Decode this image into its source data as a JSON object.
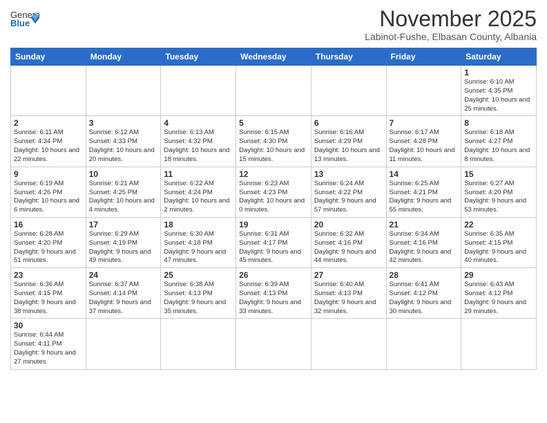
{
  "logo": {
    "general": "General",
    "blue": "Blue"
  },
  "header": {
    "month": "November 2025",
    "location": "Labinot-Fushe, Elbasan County, Albania"
  },
  "weekdays": [
    "Sunday",
    "Monday",
    "Tuesday",
    "Wednesday",
    "Thursday",
    "Friday",
    "Saturday"
  ],
  "weeks": [
    [
      {
        "day": "",
        "info": ""
      },
      {
        "day": "",
        "info": ""
      },
      {
        "day": "",
        "info": ""
      },
      {
        "day": "",
        "info": ""
      },
      {
        "day": "",
        "info": ""
      },
      {
        "day": "",
        "info": ""
      },
      {
        "day": "1",
        "info": "Sunrise: 6:10 AM\nSunset: 4:35 PM\nDaylight: 10 hours and 25 minutes."
      }
    ],
    [
      {
        "day": "2",
        "info": "Sunrise: 6:11 AM\nSunset: 4:34 PM\nDaylight: 10 hours and 22 minutes."
      },
      {
        "day": "3",
        "info": "Sunrise: 6:12 AM\nSunset: 4:33 PM\nDaylight: 10 hours and 20 minutes."
      },
      {
        "day": "4",
        "info": "Sunrise: 6:13 AM\nSunset: 4:32 PM\nDaylight: 10 hours and 18 minutes."
      },
      {
        "day": "5",
        "info": "Sunrise: 6:15 AM\nSunset: 4:30 PM\nDaylight: 10 hours and 15 minutes."
      },
      {
        "day": "6",
        "info": "Sunrise: 6:16 AM\nSunset: 4:29 PM\nDaylight: 10 hours and 13 minutes."
      },
      {
        "day": "7",
        "info": "Sunrise: 6:17 AM\nSunset: 4:28 PM\nDaylight: 10 hours and 11 minutes."
      },
      {
        "day": "8",
        "info": "Sunrise: 6:18 AM\nSunset: 4:27 PM\nDaylight: 10 hours and 8 minutes."
      }
    ],
    [
      {
        "day": "9",
        "info": "Sunrise: 6:19 AM\nSunset: 4:26 PM\nDaylight: 10 hours and 6 minutes."
      },
      {
        "day": "10",
        "info": "Sunrise: 6:21 AM\nSunset: 4:25 PM\nDaylight: 10 hours and 4 minutes."
      },
      {
        "day": "11",
        "info": "Sunrise: 6:22 AM\nSunset: 4:24 PM\nDaylight: 10 hours and 2 minutes."
      },
      {
        "day": "12",
        "info": "Sunrise: 6:23 AM\nSunset: 4:23 PM\nDaylight: 10 hours and 0 minutes."
      },
      {
        "day": "13",
        "info": "Sunrise: 6:24 AM\nSunset: 4:22 PM\nDaylight: 9 hours and 57 minutes."
      },
      {
        "day": "14",
        "info": "Sunrise: 6:25 AM\nSunset: 4:21 PM\nDaylight: 9 hours and 55 minutes."
      },
      {
        "day": "15",
        "info": "Sunrise: 6:27 AM\nSunset: 4:20 PM\nDaylight: 9 hours and 53 minutes."
      }
    ],
    [
      {
        "day": "16",
        "info": "Sunrise: 6:28 AM\nSunset: 4:20 PM\nDaylight: 9 hours and 51 minutes."
      },
      {
        "day": "17",
        "info": "Sunrise: 6:29 AM\nSunset: 4:19 PM\nDaylight: 9 hours and 49 minutes."
      },
      {
        "day": "18",
        "info": "Sunrise: 6:30 AM\nSunset: 4:18 PM\nDaylight: 9 hours and 47 minutes."
      },
      {
        "day": "19",
        "info": "Sunrise: 6:31 AM\nSunset: 4:17 PM\nDaylight: 9 hours and 45 minutes."
      },
      {
        "day": "20",
        "info": "Sunrise: 6:32 AM\nSunset: 4:16 PM\nDaylight: 9 hours and 44 minutes."
      },
      {
        "day": "21",
        "info": "Sunrise: 6:34 AM\nSunset: 4:16 PM\nDaylight: 9 hours and 42 minutes."
      },
      {
        "day": "22",
        "info": "Sunrise: 6:35 AM\nSunset: 4:15 PM\nDaylight: 9 hours and 40 minutes."
      }
    ],
    [
      {
        "day": "23",
        "info": "Sunrise: 6:36 AM\nSunset: 4:15 PM\nDaylight: 9 hours and 38 minutes."
      },
      {
        "day": "24",
        "info": "Sunrise: 6:37 AM\nSunset: 4:14 PM\nDaylight: 9 hours and 37 minutes."
      },
      {
        "day": "25",
        "info": "Sunrise: 6:38 AM\nSunset: 4:13 PM\nDaylight: 9 hours and 35 minutes."
      },
      {
        "day": "26",
        "info": "Sunrise: 6:39 AM\nSunset: 4:13 PM\nDaylight: 9 hours and 33 minutes."
      },
      {
        "day": "27",
        "info": "Sunrise: 6:40 AM\nSunset: 4:13 PM\nDaylight: 9 hours and 32 minutes."
      },
      {
        "day": "28",
        "info": "Sunrise: 6:41 AM\nSunset: 4:12 PM\nDaylight: 9 hours and 30 minutes."
      },
      {
        "day": "29",
        "info": "Sunrise: 6:43 AM\nSunset: 4:12 PM\nDaylight: 9 hours and 29 minutes."
      }
    ],
    [
      {
        "day": "30",
        "info": "Sunrise: 6:44 AM\nSunset: 4:11 PM\nDaylight: 9 hours and 27 minutes."
      },
      {
        "day": "",
        "info": ""
      },
      {
        "day": "",
        "info": ""
      },
      {
        "day": "",
        "info": ""
      },
      {
        "day": "",
        "info": ""
      },
      {
        "day": "",
        "info": ""
      },
      {
        "day": "",
        "info": ""
      }
    ]
  ]
}
